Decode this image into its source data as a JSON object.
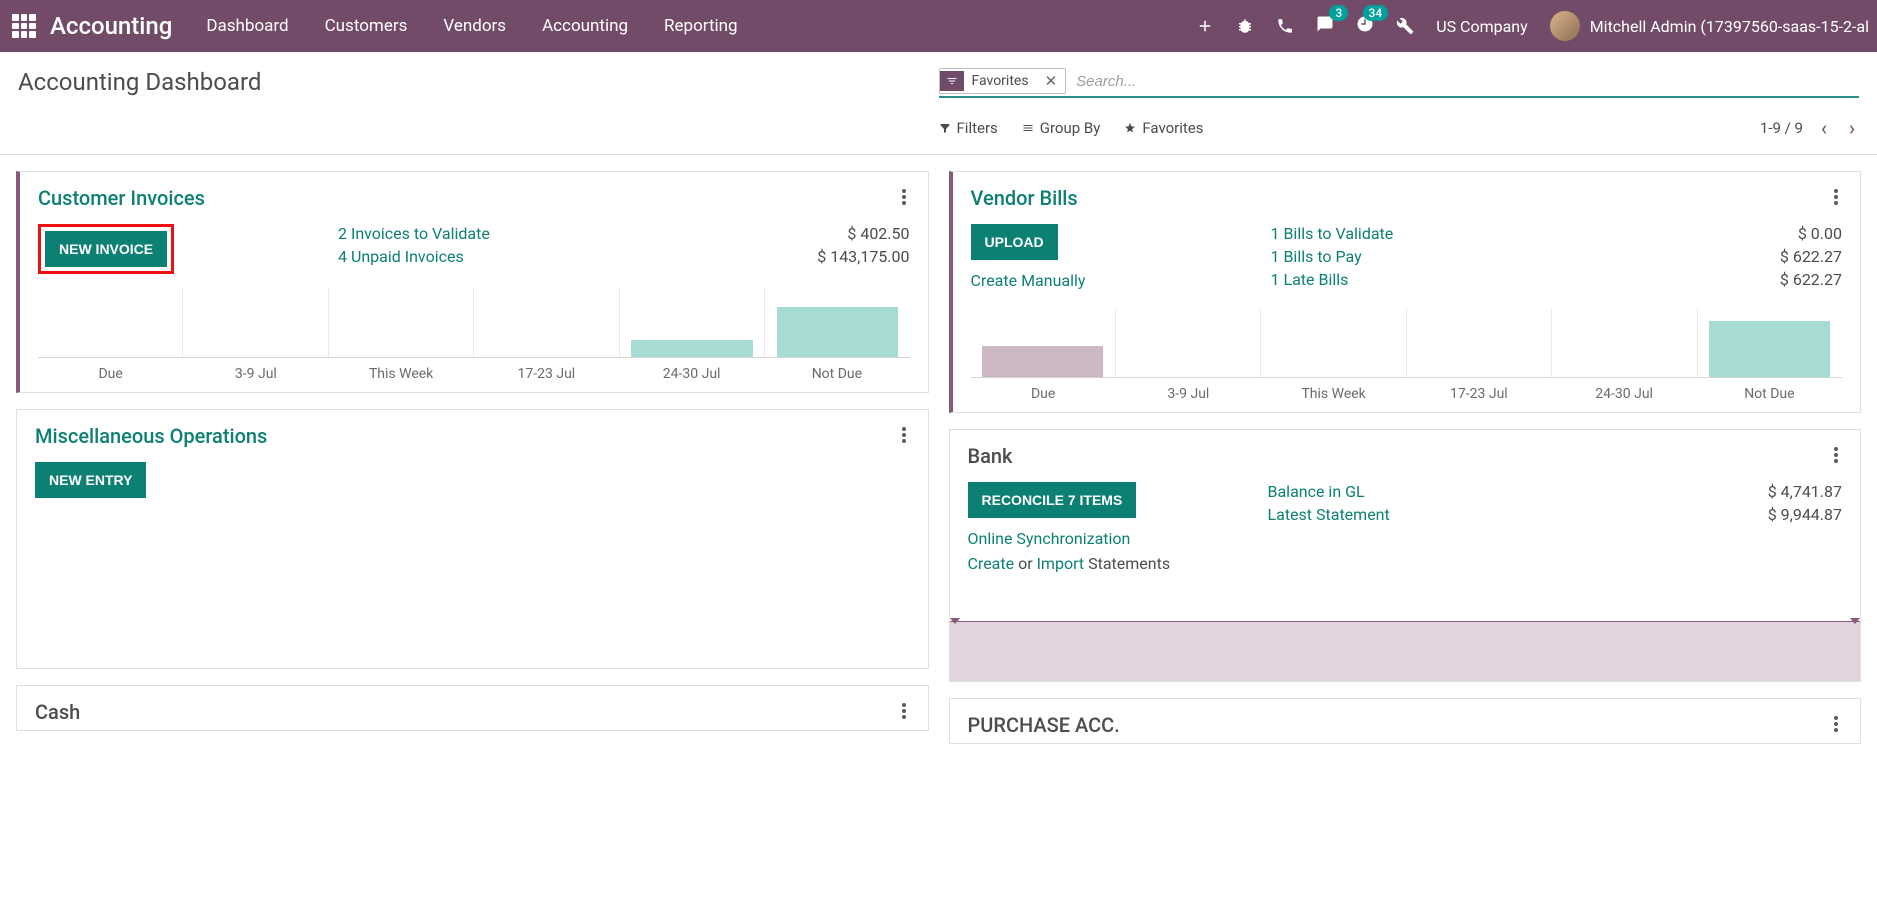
{
  "topbar": {
    "app_name": "Accounting",
    "menu": [
      "Dashboard",
      "Customers",
      "Vendors",
      "Accounting",
      "Reporting"
    ],
    "messaging_badge": "3",
    "activities_badge": "34",
    "company": "US Company",
    "user": "Mitchell Admin (17397560-saas-15-2-al"
  },
  "cp": {
    "title": "Accounting Dashboard",
    "facet_label": "Favorites",
    "search_placeholder": "Search...",
    "filters": "Filters",
    "groupby": "Group By",
    "favorites": "Favorites",
    "pager": "1-9 / 9"
  },
  "chart_data": [
    {
      "type": "bar",
      "title": "Customer Invoices",
      "categories": [
        "Due",
        "3-9 Jul",
        "This Week",
        "17-23 Jul",
        "24-30 Jul",
        "Not Due"
      ],
      "values": [
        0,
        0,
        0,
        0,
        18,
        60
      ],
      "color": "#a7dcd5"
    },
    {
      "type": "bar",
      "title": "Vendor Bills",
      "categories": [
        "Due",
        "3-9 Jul",
        "This Week",
        "17-23 Jul",
        "24-30 Jul",
        "Not Due"
      ],
      "series": [
        {
          "name": "overdue",
          "values": [
            30,
            0,
            0,
            0,
            0,
            0
          ],
          "color": "#cbb8c3"
        },
        {
          "name": "upcoming",
          "values": [
            0,
            0,
            0,
            0,
            0,
            62
          ],
          "color": "#a7dcd5"
        }
      ]
    }
  ],
  "cards": {
    "customer_invoices": {
      "title": "Customer Invoices",
      "button": "NEW INVOICE",
      "links": [
        "2 Invoices to Validate",
        "4 Unpaid Invoices"
      ],
      "values": [
        "$ 402.50",
        "$ 143,175.00"
      ]
    },
    "vendor_bills": {
      "title": "Vendor Bills",
      "button": "UPLOAD",
      "create_manually": "Create Manually",
      "links": [
        "1 Bills to Validate",
        "1 Bills to Pay",
        "1 Late Bills"
      ],
      "values": [
        "$ 0.00",
        "$ 622.27",
        "$ 622.27"
      ]
    },
    "misc": {
      "title": "Miscellaneous Operations",
      "button": "NEW ENTRY"
    },
    "bank": {
      "title": "Bank",
      "button": "RECONCILE 7 ITEMS",
      "online_sync": "Online Synchronization",
      "create": "Create",
      "or": " or ",
      "import": "Import",
      "statements": " Statements",
      "links": [
        "Balance in GL",
        "Latest Statement"
      ],
      "values": [
        "$ 4,741.87",
        "$ 9,944.87"
      ]
    },
    "cash": {
      "title": "Cash"
    },
    "purchase": {
      "title": "PURCHASE ACC."
    }
  }
}
